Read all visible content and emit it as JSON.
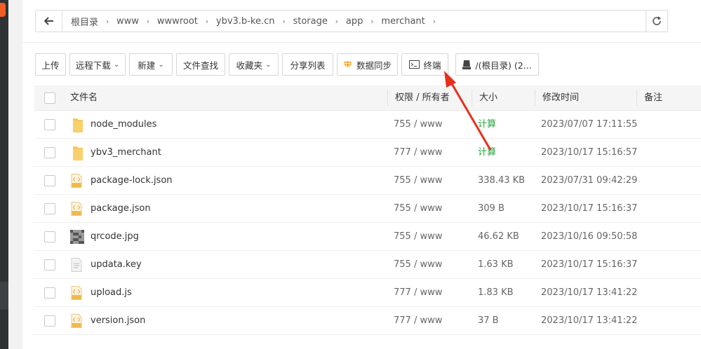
{
  "breadcrumb": {
    "items": [
      "根目录",
      "www",
      "wwwroot",
      "ybv3.b-ke.cn",
      "storage",
      "app",
      "merchant"
    ]
  },
  "toolbar": {
    "upload": "上传",
    "remote_download": "远程下载",
    "new": "新建",
    "file_search": "文件查找",
    "favorites": "收藏夹",
    "share_list": "分享列表",
    "data_sync": "数据同步",
    "terminal": "终端",
    "disk": "/(根目录) (2..."
  },
  "table": {
    "headers": {
      "name": "文件名",
      "perm": "权限 / 所有者",
      "size": "大小",
      "mtime": "修改时间",
      "note": "备注"
    },
    "rows": [
      {
        "name": "node_modules",
        "type": "folder",
        "perm": "755 / www",
        "size": "计算",
        "mtime": "2023/07/07 17:11:55"
      },
      {
        "name": "ybv3_merchant",
        "type": "folder",
        "perm": "777 / www",
        "size": "计算",
        "mtime": "2023/10/17 15:16:57"
      },
      {
        "name": "package-lock.json",
        "type": "json",
        "perm": "755 / www",
        "size": "338.43 KB",
        "mtime": "2023/07/31 09:42:29"
      },
      {
        "name": "package.json",
        "type": "json",
        "perm": "755 / www",
        "size": "309 B",
        "mtime": "2023/10/17 15:16:37"
      },
      {
        "name": "qrcode.jpg",
        "type": "image",
        "perm": "755 / www",
        "size": "46.62 KB",
        "mtime": "2023/10/16 09:50:58"
      },
      {
        "name": "updata.key",
        "type": "text",
        "perm": "755 / www",
        "size": "1.63 KB",
        "mtime": "2023/10/17 15:16:37"
      },
      {
        "name": "upload.js",
        "type": "js",
        "perm": "777 / www",
        "size": "1.83 KB",
        "mtime": "2023/10/17 13:41:22"
      },
      {
        "name": "version.json",
        "type": "json",
        "perm": "777 / www",
        "size": "37 B",
        "mtime": "2023/10/17 13:41:22"
      }
    ]
  },
  "colors": {
    "accent_green": "#20a53a",
    "annotation_arrow": "#e8301c",
    "folder": "#f7c85a"
  }
}
